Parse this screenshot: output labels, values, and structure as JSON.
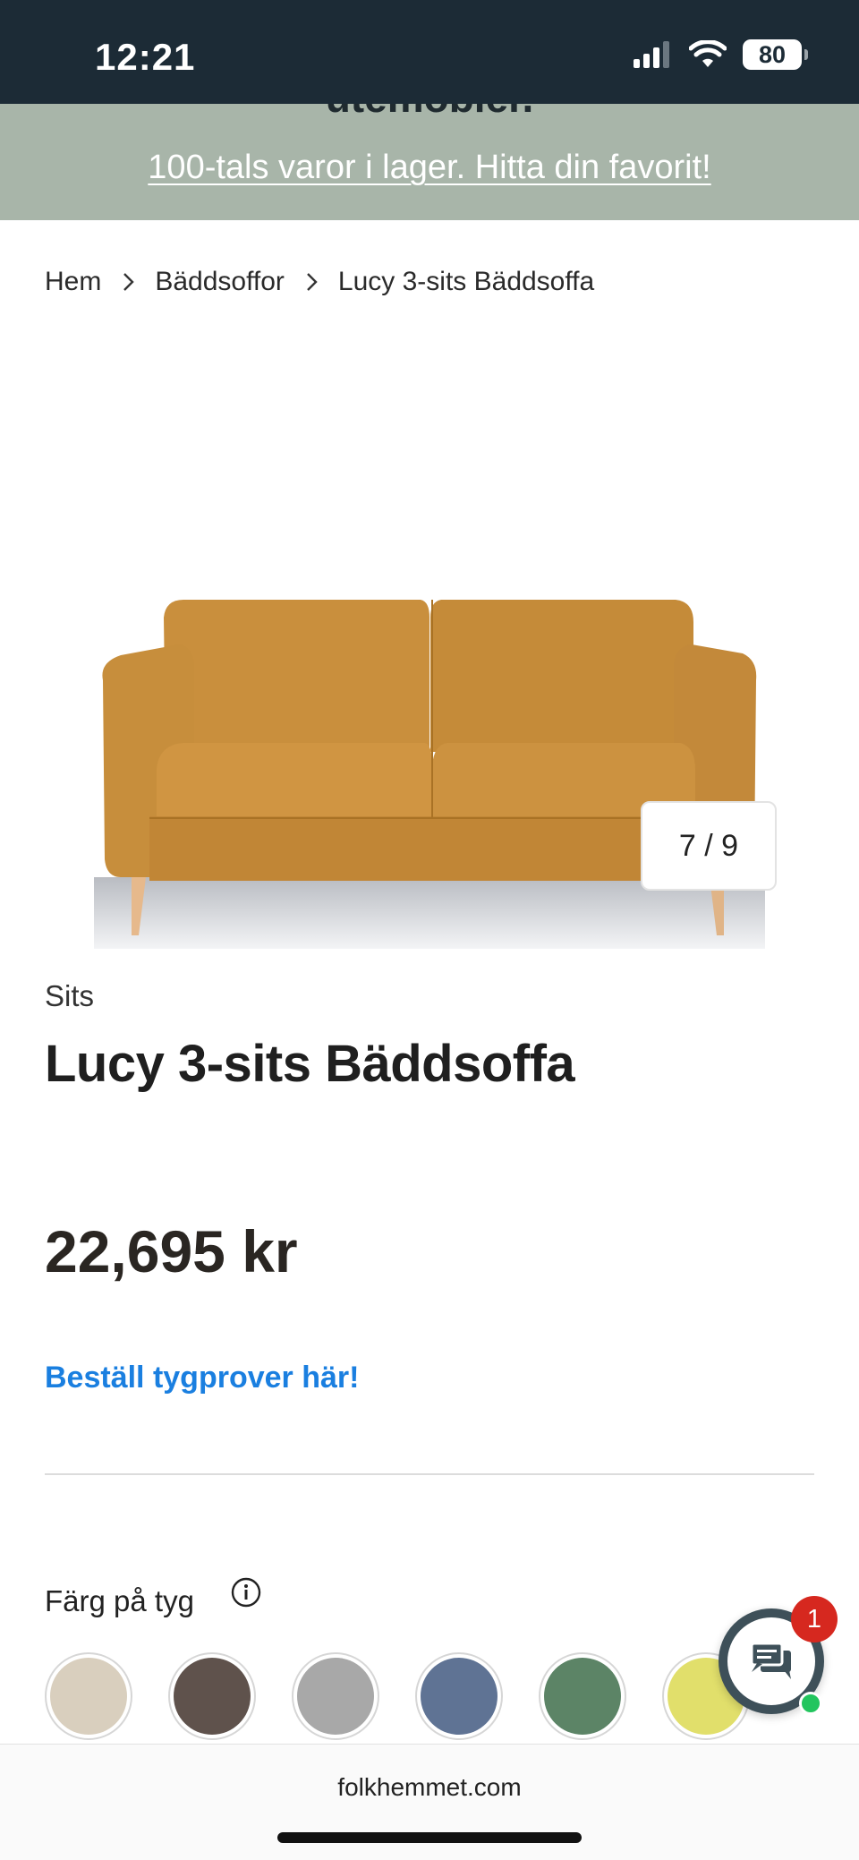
{
  "status_bar": {
    "time": "12:21",
    "battery": "80"
  },
  "promo": {
    "cut_text": "utemöbler.",
    "link": "100-tals varor i lager. Hitta din favorit!"
  },
  "breadcrumb": [
    "Hem",
    "Bäddsoffor",
    "Lucy 3-sits Bäddsoffa"
  ],
  "gallery": {
    "counter": "7 / 9",
    "image": "mustard-sofa"
  },
  "product": {
    "category": "Sits",
    "title": "Lucy 3-sits Bäddsoffa",
    "price": "22,695 kr",
    "sample_link": "Beställ tygprover här!"
  },
  "color_picker": {
    "label": "Färg på tyg",
    "swatches": [
      "#d9cfbe",
      "#5f524c",
      "#a8a8a8",
      "#5f7394",
      "#5c8466",
      "#e1df6b"
    ]
  },
  "chat": {
    "badge": "1"
  },
  "browser": {
    "url": "folkhemmet.com"
  },
  "colors": {
    "status_bar": "#1c2b36",
    "promo_bg": "#a8b5a9",
    "link": "#1a7fe0",
    "badge": "#d6281f",
    "online": "#22c55e"
  }
}
